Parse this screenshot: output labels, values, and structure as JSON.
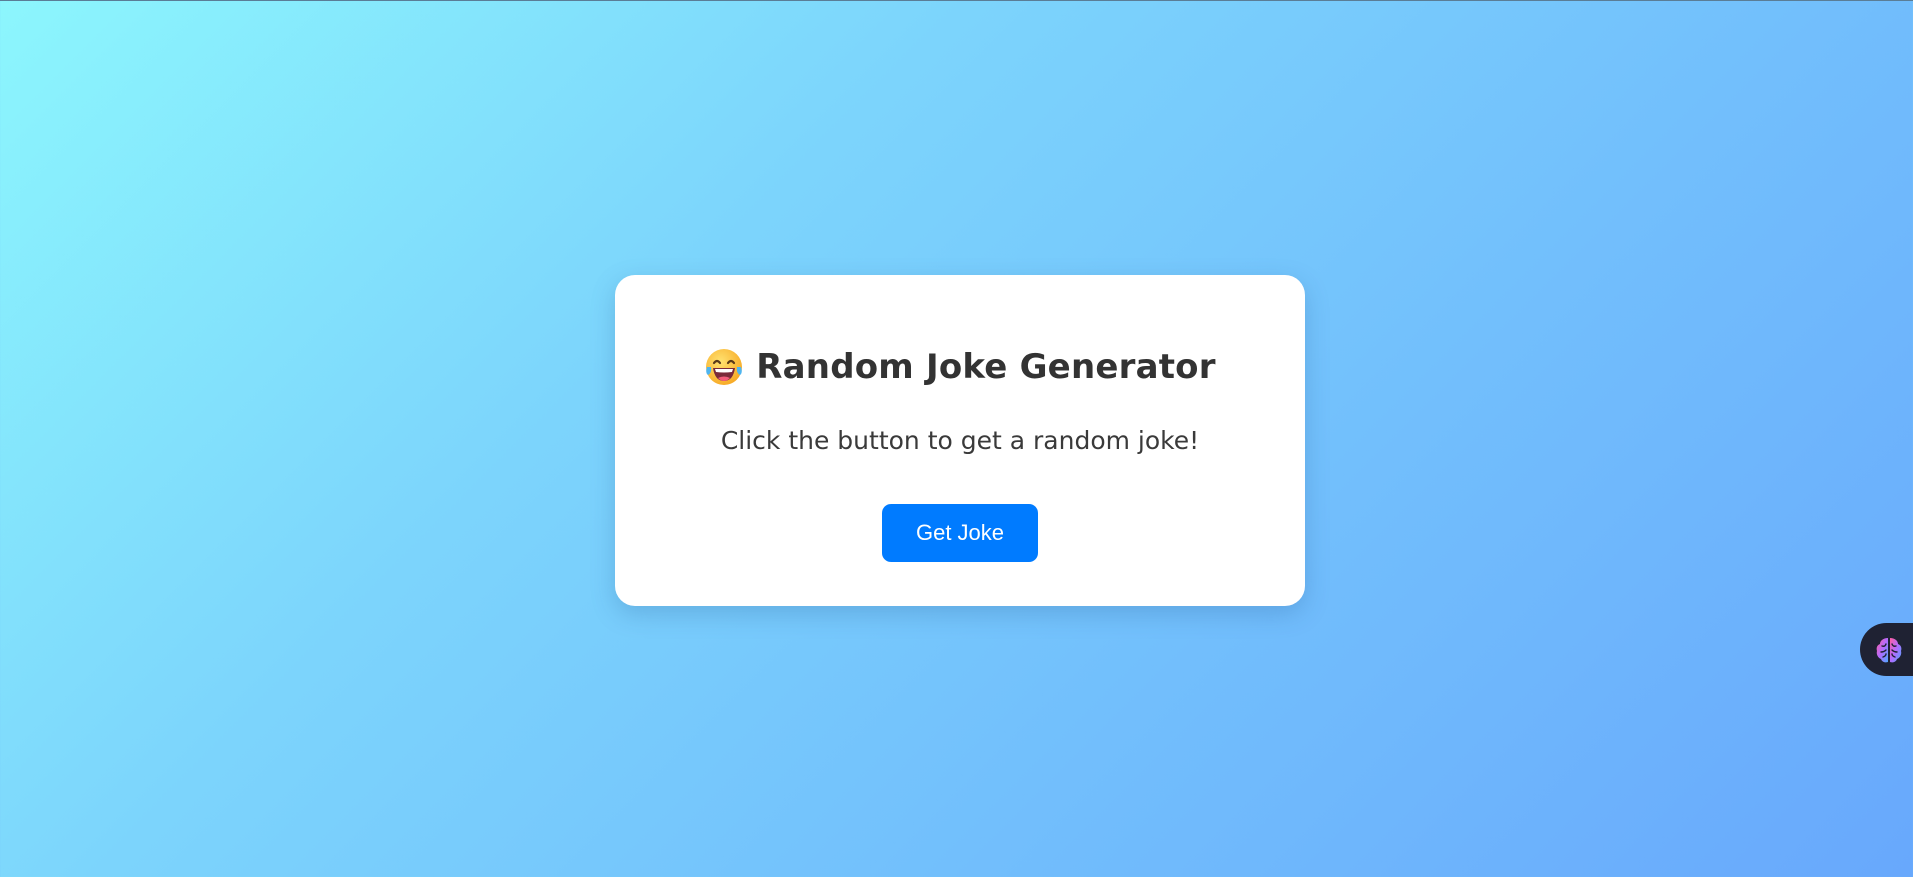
{
  "card": {
    "title": "Random Joke Generator",
    "title_icon": "laughing-tears-emoji-icon",
    "subtitle": "Click the button to get a random joke!",
    "button_label": "Get Joke"
  },
  "floating_widget": {
    "icon": "brain-icon"
  },
  "colors": {
    "button": "#007bff",
    "card_background": "#ffffff",
    "text": "#333333",
    "gradient_start": "#8cf6fd",
    "gradient_end": "#68a8fc",
    "widget_background": "#1f2233"
  }
}
